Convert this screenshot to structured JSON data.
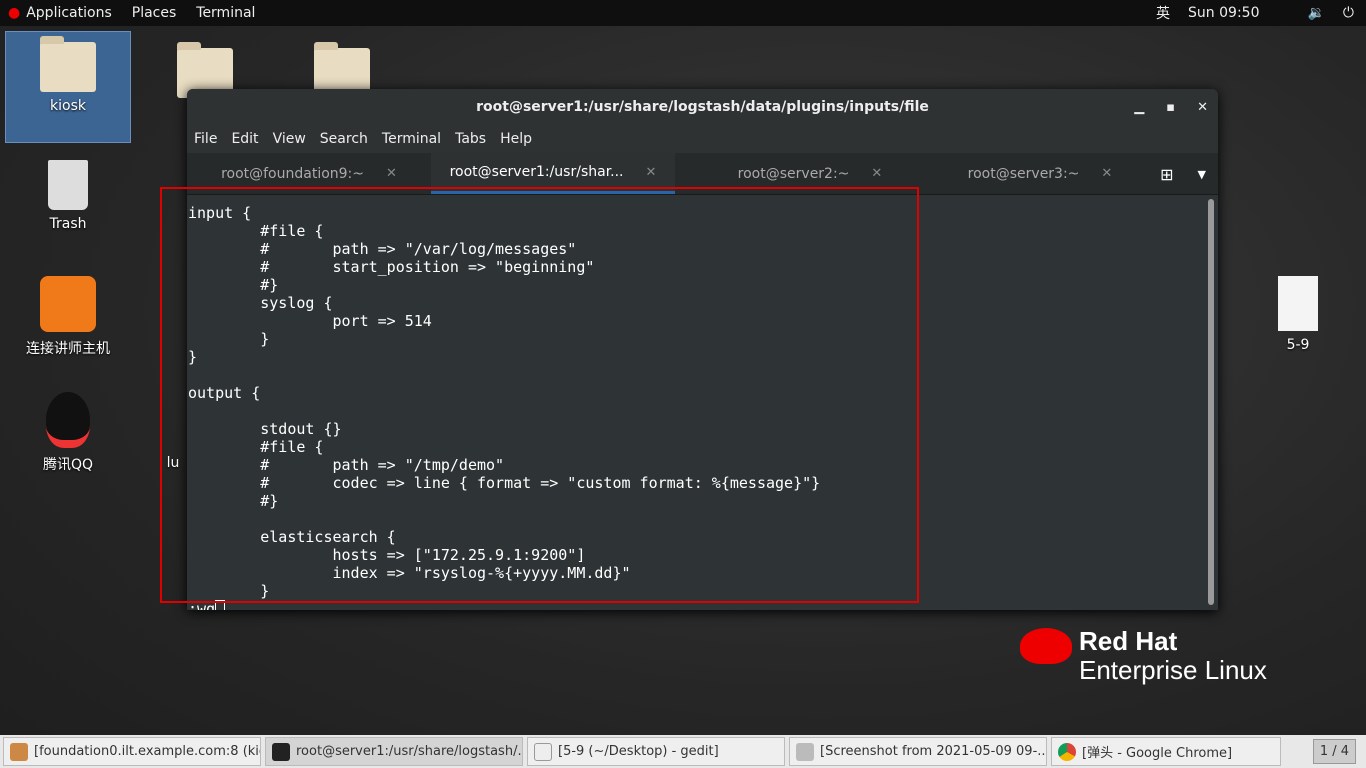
{
  "topbar": {
    "applications": "Applications",
    "places": "Places",
    "terminal": "Terminal",
    "ime": "英",
    "clock": "Sun 09:50"
  },
  "desktop": {
    "icons": [
      {
        "label": "kiosk"
      },
      {
        "label": "Trash"
      },
      {
        "label": "连接讲师主机"
      },
      {
        "label": "腾讯QQ"
      },
      {
        "label": "5-9"
      },
      {
        "label": "lu"
      }
    ]
  },
  "window": {
    "title": "root@server1:/usr/share/logstash/data/plugins/inputs/file",
    "menu": [
      "File",
      "Edit",
      "View",
      "Search",
      "Terminal",
      "Tabs",
      "Help"
    ],
    "tabs": [
      {
        "label": "root@foundation9:~"
      },
      {
        "label": "root@server1:/usr/shar..."
      },
      {
        "label": "root@server2:~"
      },
      {
        "label": "root@server3:~"
      }
    ],
    "active_tab": 1,
    "content": "input {\n\t#file {\n\t#\tpath => \"/var/log/messages\"\n\t#\tstart_position => \"beginning\"\n\t#}\n\tsyslog {\n\t\tport => 514\n\t}\n}\n\noutput {\n\n\tstdout {}\n\t#file {\n\t#\tpath => \"/tmp/demo\"\n\t#\tcodec => line { format => \"custom format: %{message}\"}\n\t#}\n\n\telasticsearch {\n\t\thosts => [\"172.25.9.1:9200\"]\n\t\tindex => \"rsyslog-%{+yyyy.MM.dd}\"\n\t}\n",
    "command": ":wq"
  },
  "branding": {
    "line1": "Red Hat",
    "line2": "Enterprise Linux"
  },
  "taskbar": {
    "items": [
      {
        "label": "[foundation0.ilt.example.com:8 (kio..."
      },
      {
        "label": "root@server1:/usr/share/logstash/..."
      },
      {
        "label": "[5-9 (~/Desktop) - gedit]"
      },
      {
        "label": "[Screenshot from 2021-05-09 09-..."
      },
      {
        "label": "[弹头 - Google Chrome]"
      }
    ],
    "pager": "1 / 4"
  },
  "colors": {
    "highlight": "#e00000",
    "tab_accent": "#2a64a8"
  }
}
